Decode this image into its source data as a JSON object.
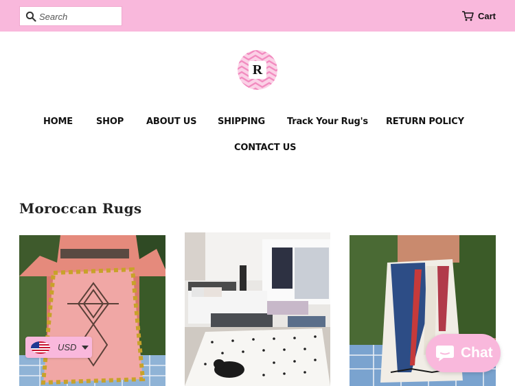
{
  "header": {
    "search_placeholder": "Search",
    "cart_label": "Cart",
    "logo_letter": "R"
  },
  "nav": {
    "items": [
      "HOME",
      "SHOP",
      "ABOUT US",
      "SHIPPING",
      "Track Your Rug's",
      "RETURN POLICY",
      "CONTACT US"
    ]
  },
  "collection": {
    "title": "Moroccan Rugs"
  },
  "currency": {
    "selected": "USD"
  },
  "chat": {
    "label": "Chat"
  },
  "colors": {
    "brand_pink": "#f9b8dc",
    "text": "#111111"
  }
}
